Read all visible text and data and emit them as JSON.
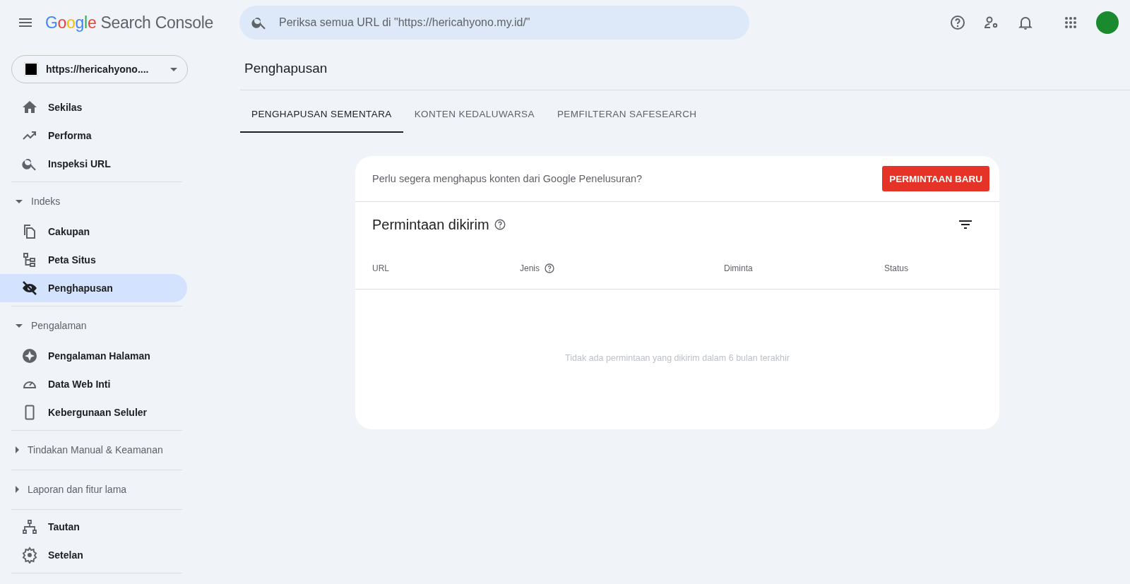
{
  "header": {
    "logo_brand": "Google",
    "logo_product": "Search Console",
    "search": {
      "placeholder": "Periksa semua URL di \"https://hericahyono.my.id/\""
    }
  },
  "property": {
    "label": "https://hericahyono...."
  },
  "sidebar": {
    "groups": [
      {
        "items": [
          {
            "label": "Sekilas",
            "selected": false
          },
          {
            "label": "Performa",
            "selected": false
          },
          {
            "label": "Inspeksi URL",
            "selected": false
          }
        ]
      },
      {
        "header": "Indeks",
        "expanded": true,
        "items": [
          {
            "label": "Cakupan",
            "selected": false
          },
          {
            "label": "Peta Situs",
            "selected": false
          },
          {
            "label": "Penghapusan",
            "selected": true
          }
        ]
      },
      {
        "header": "Pengalaman",
        "expanded": true,
        "items": [
          {
            "label": "Pengalaman Halaman",
            "selected": false
          },
          {
            "label": "Data Web Inti",
            "selected": false
          },
          {
            "label": "Kebergunaan Seluler",
            "selected": false
          }
        ]
      },
      {
        "header": "Tindakan Manual & Keamanan",
        "expanded": false
      },
      {
        "header": "Laporan dan fitur lama",
        "expanded": false
      },
      {
        "items": [
          {
            "label": "Tautan",
            "selected": false
          },
          {
            "label": "Setelan",
            "selected": false
          }
        ]
      }
    ]
  },
  "page": {
    "title": "Penghapusan",
    "tabs": [
      {
        "label": "PENGHAPUSAN SEMENTARA",
        "selected": true
      },
      {
        "label": "KONTEN KEDALUWARSA",
        "selected": false
      },
      {
        "label": "PEMFILTERAN SAFESEARCH",
        "selected": false
      }
    ],
    "card": {
      "prompt": "Perlu segera menghapus konten dari Google Penelusuran?",
      "button": "PERMINTAAN BARU",
      "title": "Permintaan dikirim",
      "columns": [
        {
          "label": "URL",
          "help": false
        },
        {
          "label": "Jenis",
          "help": true
        },
        {
          "label": "Diminta",
          "help": false
        },
        {
          "label": "Status",
          "help": false
        }
      ],
      "empty_message": "Tidak ada permintaan yang dikirim dalam 6 bulan terakhir"
    }
  }
}
